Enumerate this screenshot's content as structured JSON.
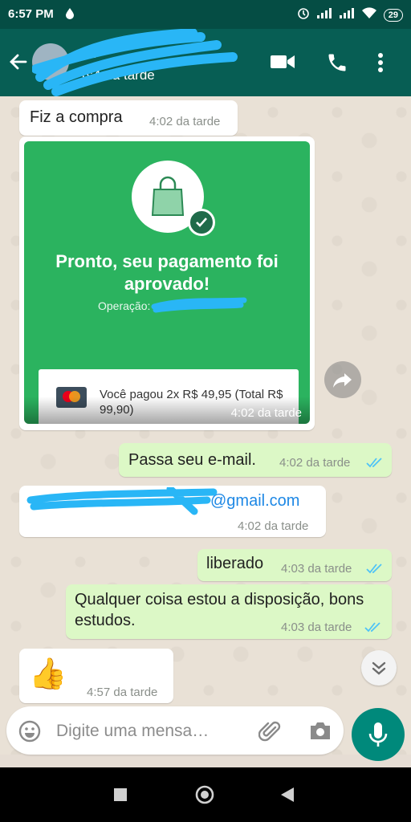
{
  "status_bar": {
    "time": "6:57 PM",
    "battery": "29"
  },
  "header": {
    "contact_name": "…",
    "last_seen": "6:4 da tarde"
  },
  "messages": [
    {
      "text": "Fiz a compra",
      "time": "4:02 da tarde"
    },
    {
      "payment": {
        "title": "Pronto, seu pagamento foi aprovado!",
        "operation_label": "Operação:",
        "paid_text": "Você pagou 2x R$ 49,95 (Total R$ 99,90)",
        "time": "4:02 da tarde"
      }
    },
    {
      "text": "Passa seu e-mail.",
      "time": "4:02 da tarde"
    },
    {
      "text": "@gmail.com",
      "time": "4:02 da tarde"
    },
    {
      "text": "liberado",
      "time": "4:03 da tarde"
    },
    {
      "text": "Qualquer coisa estou a disposição, bons estudos.",
      "time": "4:03 da tarde"
    },
    {
      "text": "👍",
      "time": "4:57 da tarde"
    }
  ],
  "composer": {
    "placeholder": "Digite uma mensa…"
  },
  "colors": {
    "header": "#075e54",
    "statusbar": "#054d44",
    "outgoing": "#dcf8c6",
    "accent": "#00897b",
    "payment_green": "#2bb35f",
    "read_ticks": "#4fc3f7"
  }
}
